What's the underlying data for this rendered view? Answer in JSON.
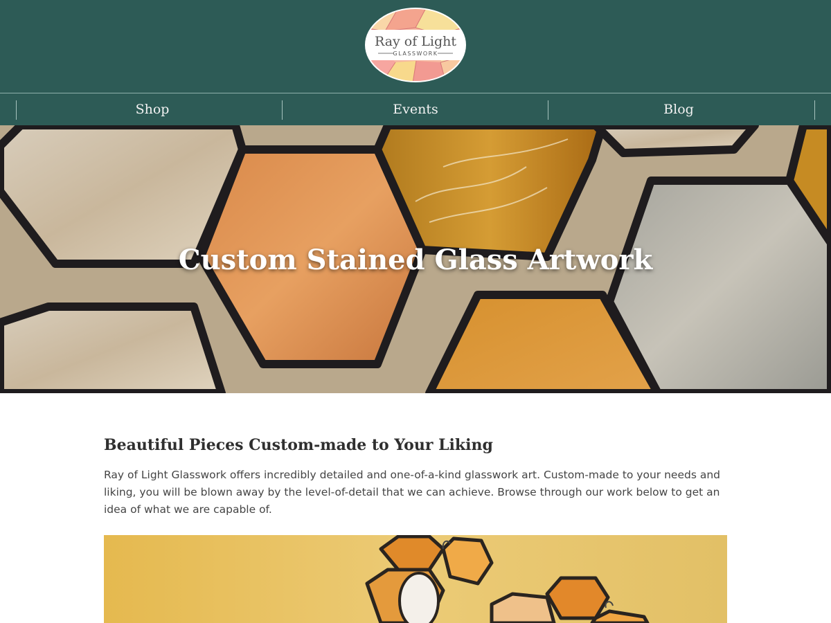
{
  "logo": {
    "name": "Ray of Light",
    "tagline": "GLASSWORK"
  },
  "nav": {
    "items": [
      "Shop",
      "Events",
      "Blog"
    ]
  },
  "hero": {
    "title": "Custom Stained Glass Artwork"
  },
  "main": {
    "heading": "Beautiful Pieces Custom-made to Your Liking",
    "body": "Ray of Light Glasswork offers incredibly detailed and one-of-a-kind glasswork art. Custom-made to your needs and liking, you will be blown away by the level-of-detail that we can achieve. Browse through our work below to get an idea of what we are capable of."
  },
  "colors": {
    "header_bg": "#2d5b56",
    "nav_text": "#f3f3f3",
    "hero_text": "#ffffff"
  }
}
